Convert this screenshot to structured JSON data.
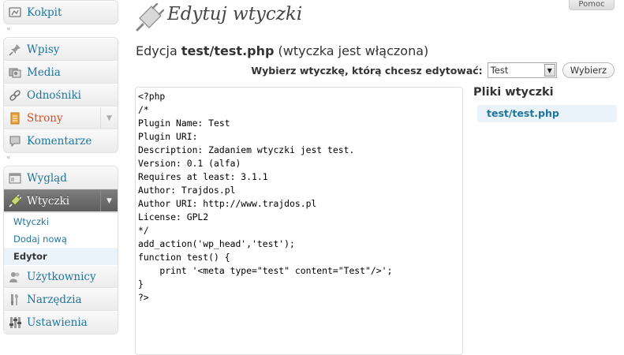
{
  "header": {
    "help_label": "Pomoc"
  },
  "sidebar": {
    "group1": [
      {
        "label": "Kokpit",
        "icon": "dashboard-icon"
      }
    ],
    "group2": [
      {
        "label": "Wpisy",
        "icon": "pin-icon"
      },
      {
        "label": "Media",
        "icon": "media-icon"
      },
      {
        "label": "Odnośniki",
        "icon": "links-icon"
      },
      {
        "label": "Strony",
        "icon": "pages-icon"
      },
      {
        "label": "Komentarze",
        "icon": "comments-icon"
      }
    ],
    "group3_top": [
      {
        "label": "Wygląd",
        "icon": "appearance-icon"
      },
      {
        "label": "Wtyczki",
        "icon": "plugins-icon"
      }
    ],
    "plugins_submenu": [
      "Wtyczki",
      "Dodaj nową",
      "Edytor"
    ],
    "group3_bottom": [
      {
        "label": "Użytkownicy",
        "icon": "users-icon"
      },
      {
        "label": "Narzędzia",
        "icon": "tools-icon"
      },
      {
        "label": "Ustawienia",
        "icon": "settings-icon"
      }
    ]
  },
  "page": {
    "title": "Edytuj wtyczki",
    "subtitle_prefix": "Edycja ",
    "subtitle_file": "test/test.php",
    "subtitle_suffix": " (wtyczka jest włączona)"
  },
  "plugin_selector": {
    "label": "Wybierz wtyczkę, którą chcesz edytować:",
    "selected": "Test",
    "button_label": "Wybierz"
  },
  "editor": {
    "content": "<?php\n/*\nPlugin Name: Test\nPlugin URI:\nDescription: Zadaniem wtyczki jest test.\nVersion: 0.1 (alfa)\nRequires at least: 3.1.1\nAuthor: Trajdos.pl\nAuthor URI: http://www.trajdos.pl\nLicense: GPL2\n*/\nadd_action('wp_head','test');\nfunction test() {\n    print '<meta type=\"test\" content=\"Test\"/>';\n}\n?>"
  },
  "files_panel": {
    "title": "Pliki wtyczki",
    "files": [
      "test/test.php"
    ]
  },
  "colors": {
    "link": "#21759b",
    "current_menu_bg": "#6d6d6d",
    "highlight": "#eaf2fa",
    "pages_label": "#d54e21"
  }
}
